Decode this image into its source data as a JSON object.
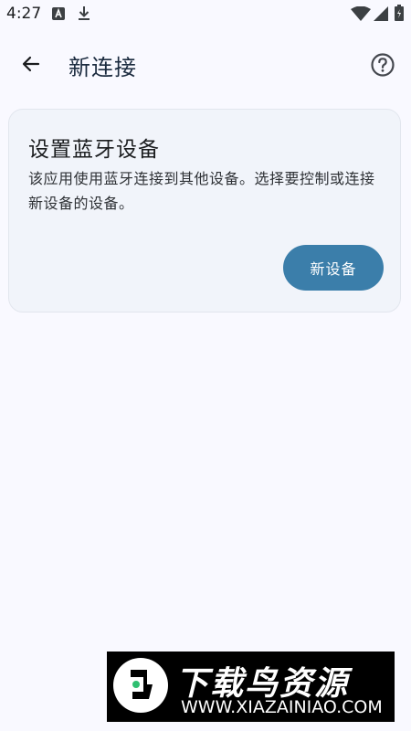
{
  "status_bar": {
    "time": "4:27",
    "icons": [
      "a-app-icon",
      "download-icon",
      "wifi-icon",
      "signal-icon",
      "battery-icon"
    ]
  },
  "app_bar": {
    "title": "新连接",
    "back_icon": "arrow-left-icon",
    "help_icon": "help-circle-icon"
  },
  "card": {
    "title": "设置蓝牙设备",
    "description": "该应用使用蓝牙连接到其他设备。选择要控制或连接新设备的设备。",
    "button_label": "新设备"
  },
  "watermark": {
    "title": "下载鸟资源",
    "url": "WWW.XIAZAINIAO.COM"
  },
  "colors": {
    "background": "#f9f9ff",
    "card": "#f1f4fa",
    "accent": "#3b7eaa",
    "title": "#1b2b3f"
  }
}
